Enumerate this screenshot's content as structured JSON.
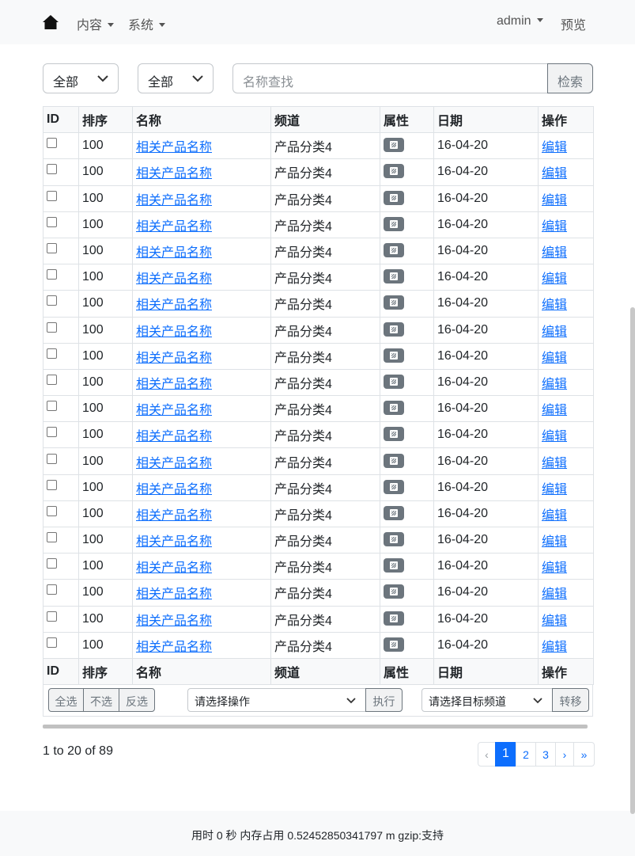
{
  "nav": {
    "home_icon": "home-icon",
    "content_label": "内容",
    "system_label": "系统",
    "user_label": "admin",
    "preview_label": "预览"
  },
  "filters": {
    "filter1_value": "全部",
    "filter2_value": "全部",
    "search_placeholder": "名称查找",
    "search_button": "检索"
  },
  "table": {
    "headers": {
      "id": "ID",
      "sort": "排序",
      "name": "名称",
      "channel": "频道",
      "attr": "属性",
      "date": "日期",
      "action": "操作"
    },
    "rows": [
      {
        "sort": "100",
        "name": "相关产品名称",
        "channel": "产品分类4",
        "attr_icon": "image-icon",
        "date": "16-04-20",
        "action": "编辑"
      },
      {
        "sort": "100",
        "name": "相关产品名称",
        "channel": "产品分类4",
        "attr_icon": "image-icon",
        "date": "16-04-20",
        "action": "编辑"
      },
      {
        "sort": "100",
        "name": "相关产品名称",
        "channel": "产品分类4",
        "attr_icon": "image-icon",
        "date": "16-04-20",
        "action": "编辑"
      },
      {
        "sort": "100",
        "name": "相关产品名称",
        "channel": "产品分类4",
        "attr_icon": "image-icon",
        "date": "16-04-20",
        "action": "编辑"
      },
      {
        "sort": "100",
        "name": "相关产品名称",
        "channel": "产品分类4",
        "attr_icon": "image-icon",
        "date": "16-04-20",
        "action": "编辑"
      },
      {
        "sort": "100",
        "name": "相关产品名称",
        "channel": "产品分类4",
        "attr_icon": "image-icon",
        "date": "16-04-20",
        "action": "编辑"
      },
      {
        "sort": "100",
        "name": "相关产品名称",
        "channel": "产品分类4",
        "attr_icon": "image-icon",
        "date": "16-04-20",
        "action": "编辑"
      },
      {
        "sort": "100",
        "name": "相关产品名称",
        "channel": "产品分类4",
        "attr_icon": "image-icon",
        "date": "16-04-20",
        "action": "编辑"
      },
      {
        "sort": "100",
        "name": "相关产品名称",
        "channel": "产品分类4",
        "attr_icon": "image-icon",
        "date": "16-04-20",
        "action": "编辑"
      },
      {
        "sort": "100",
        "name": "相关产品名称",
        "channel": "产品分类4",
        "attr_icon": "image-icon",
        "date": "16-04-20",
        "action": "编辑"
      },
      {
        "sort": "100",
        "name": "相关产品名称",
        "channel": "产品分类4",
        "attr_icon": "image-icon",
        "date": "16-04-20",
        "action": "编辑"
      },
      {
        "sort": "100",
        "name": "相关产品名称",
        "channel": "产品分类4",
        "attr_icon": "image-icon",
        "date": "16-04-20",
        "action": "编辑"
      },
      {
        "sort": "100",
        "name": "相关产品名称",
        "channel": "产品分类4",
        "attr_icon": "image-icon",
        "date": "16-04-20",
        "action": "编辑"
      },
      {
        "sort": "100",
        "name": "相关产品名称",
        "channel": "产品分类4",
        "attr_icon": "image-icon",
        "date": "16-04-20",
        "action": "编辑"
      },
      {
        "sort": "100",
        "name": "相关产品名称",
        "channel": "产品分类4",
        "attr_icon": "image-icon",
        "date": "16-04-20",
        "action": "编辑"
      },
      {
        "sort": "100",
        "name": "相关产品名称",
        "channel": "产品分类4",
        "attr_icon": "image-icon",
        "date": "16-04-20",
        "action": "编辑"
      },
      {
        "sort": "100",
        "name": "相关产品名称",
        "channel": "产品分类4",
        "attr_icon": "image-icon",
        "date": "16-04-20",
        "action": "编辑"
      },
      {
        "sort": "100",
        "name": "相关产品名称",
        "channel": "产品分类4",
        "attr_icon": "image-icon",
        "date": "16-04-20",
        "action": "编辑"
      },
      {
        "sort": "100",
        "name": "相关产品名称",
        "channel": "产品分类4",
        "attr_icon": "image-icon",
        "date": "16-04-20",
        "action": "编辑"
      },
      {
        "sort": "100",
        "name": "相关产品名称",
        "channel": "产品分类4",
        "attr_icon": "image-icon",
        "date": "16-04-20",
        "action": "编辑"
      }
    ]
  },
  "toolbar": {
    "select_all": "全选",
    "select_none": "不选",
    "invert": "反选",
    "action_select": "请选择操作",
    "execute": "执行",
    "channel_select": "请选择目标频道",
    "move": "转移"
  },
  "pagination": {
    "summary": "1 to 20 of 89",
    "prev": "‹",
    "pages": [
      "1",
      "2",
      "3"
    ],
    "current": "1",
    "next": "›",
    "last": "»"
  },
  "footer": {
    "text": "用时 0 秒  内存占用 0.52452850341797 m  gzip:支持"
  }
}
